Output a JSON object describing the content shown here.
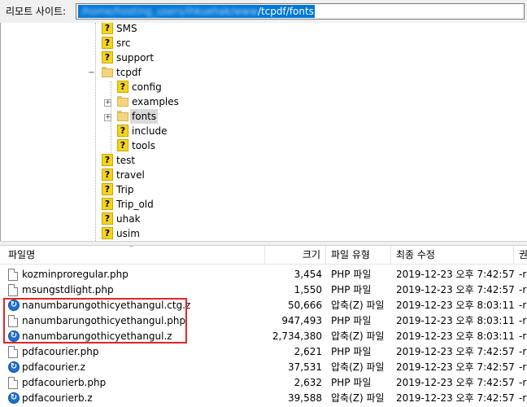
{
  "site_bar": {
    "label": "리모트 사이트:",
    "path_hidden": "/home/hosting_users/ihkuehak/www",
    "path_visible": "/tcpdf/fonts"
  },
  "tree": {
    "items": [
      {
        "label": "SMS",
        "icon": "question-folder-icon"
      },
      {
        "label": "src",
        "icon": "question-folder-icon"
      },
      {
        "label": "support",
        "icon": "question-folder-icon"
      },
      {
        "label": "tcpdf",
        "icon": "folder-icon",
        "expanded": true
      },
      {
        "label": "config",
        "icon": "question-folder-icon"
      },
      {
        "label": "examples",
        "icon": "folder-icon",
        "expandable": true
      },
      {
        "label": "fonts",
        "icon": "folder-icon",
        "expandable": true,
        "selected": true
      },
      {
        "label": "include",
        "icon": "question-folder-icon"
      },
      {
        "label": "tools",
        "icon": "question-folder-icon"
      },
      {
        "label": "test",
        "icon": "question-folder-icon"
      },
      {
        "label": "travel",
        "icon": "question-folder-icon"
      },
      {
        "label": "Trip",
        "icon": "question-folder-icon"
      },
      {
        "label": "Trip_old",
        "icon": "question-folder-icon"
      },
      {
        "label": "uhak",
        "icon": "question-folder-icon"
      },
      {
        "label": "usim",
        "icon": "question-folder-icon"
      }
    ],
    "question_mark": "?",
    "collapse_sign": "−",
    "expand_sign": "+"
  },
  "file_list": {
    "columns": {
      "name": "파일명",
      "size": "크기",
      "type": "파일 유형",
      "modified": "최종 수정",
      "permissions": "권"
    },
    "sort_indicator": "^",
    "rows": [
      {
        "name": "kozminproregular.php",
        "size": "3,454",
        "type": "PHP 파일",
        "modified": "2019-12-23 오후 7:42:57",
        "perm": "-r",
        "icon": "php-file-icon"
      },
      {
        "name": "msungstdlight.php",
        "size": "1,550",
        "type": "PHP 파일",
        "modified": "2019-12-23 오후 7:42:57",
        "perm": "-r",
        "icon": "php-file-icon"
      },
      {
        "name": "nanumbarungothicyethangul.ctg.z",
        "size": "50,666",
        "type": "압축(Z) 파일",
        "modified": "2019-12-23 오후 8:03:11",
        "perm": "-r",
        "icon": "z-archive-icon"
      },
      {
        "name": "nanumbarungothicyethangul.php",
        "size": "947,493",
        "type": "PHP 파일",
        "modified": "2019-12-23 오후 8:03:11",
        "perm": "-r",
        "icon": "php-file-icon"
      },
      {
        "name": "nanumbarungothicyethangul.z",
        "size": "2,734,380",
        "type": "압축(Z) 파일",
        "modified": "2019-12-23 오후 8:03:11",
        "perm": "-r",
        "icon": "z-archive-icon"
      },
      {
        "name": "pdfacourier.php",
        "size": "2,621",
        "type": "PHP 파일",
        "modified": "2019-12-23 오후 7:42:57",
        "perm": "-r",
        "icon": "php-file-icon"
      },
      {
        "name": "pdfacourier.z",
        "size": "37,531",
        "type": "압축(Z) 파일",
        "modified": "2019-12-23 오후 7:42:57",
        "perm": "-r",
        "icon": "z-archive-icon"
      },
      {
        "name": "pdfacourierb.php",
        "size": "2,632",
        "type": "PHP 파일",
        "modified": "2019-12-23 오후 7:42:57",
        "perm": "-r",
        "icon": "php-file-icon"
      },
      {
        "name": "pdfacourierb.z",
        "size": "39,588",
        "type": "압축(Z) 파일",
        "modified": "2019-12-23 오후 7:42:57",
        "perm": "-r",
        "icon": "z-archive-icon"
      }
    ]
  },
  "colors": {
    "selection": "#0078d7",
    "highlight_box": "#e0262a",
    "question_icon": "#f6d41e",
    "folder": "#f4d57b",
    "archive_icon": "#1f6fd0"
  }
}
